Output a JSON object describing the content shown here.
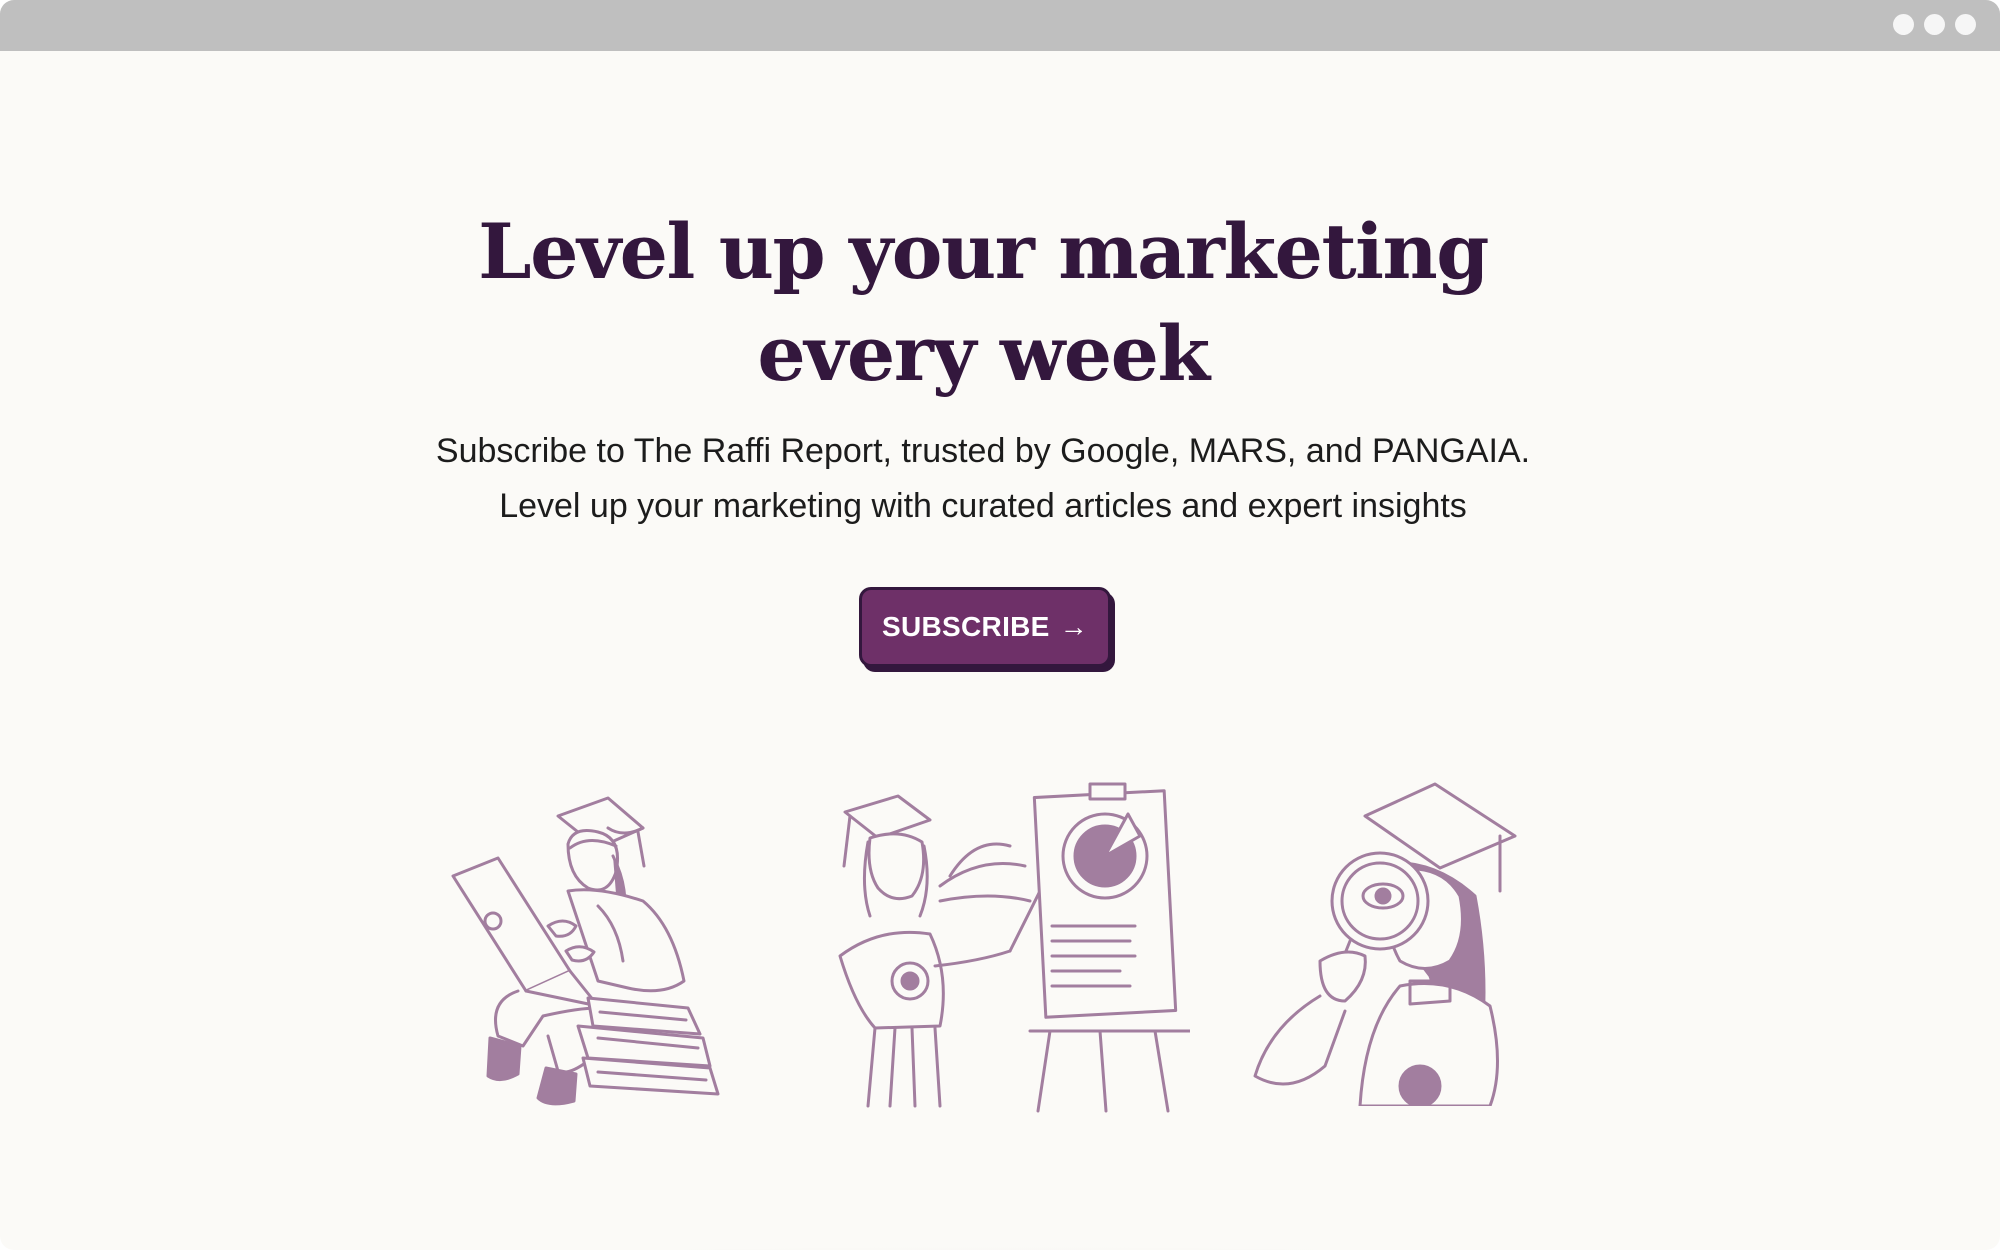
{
  "window": {
    "controls": [
      "dot",
      "dot",
      "dot"
    ]
  },
  "hero": {
    "headline_line1": "Level up your marketing",
    "headline_line2": "every week",
    "subtitle_line1": "Subscribe to The Raffi Report, trusted by Google, MARS, and PANGAIA.",
    "subtitle_line2": "Level up your marketing with curated articles and expert insights",
    "cta_label": "SUBSCRIBE",
    "cta_arrow": "→"
  },
  "illustrations": [
    {
      "name": "graduate-with-laptop-on-books",
      "icon": "laptop-student-illustration"
    },
    {
      "name": "graduate-presenting-pie-chart",
      "icon": "presenter-easel-illustration"
    },
    {
      "name": "graduate-with-magnifying-glass",
      "icon": "magnifier-student-illustration"
    }
  ],
  "colors": {
    "background": "#fbfaf7",
    "titlebar": "#bfbfbf",
    "headline": "#33173d",
    "button": "#6e3068",
    "illustration": "#a27e9f"
  }
}
